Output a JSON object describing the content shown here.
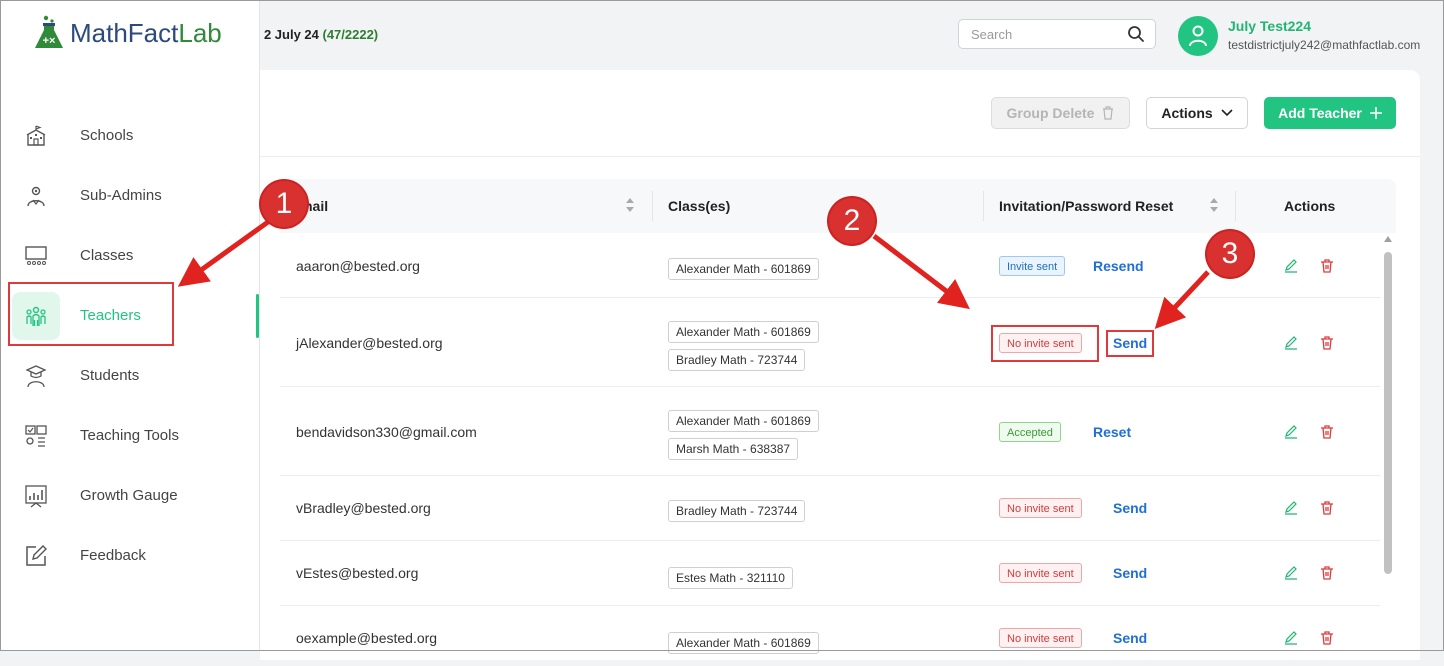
{
  "app": {
    "logo_main": "MathFact",
    "logo_accent": "Lab"
  },
  "header": {
    "term_text": ": 2 July 24 ",
    "term_count": "(47/2222)",
    "search_placeholder": "Search",
    "user_name": "July  Test224",
    "user_email": "testdistrictjuly242@mathfactlab.com"
  },
  "sidebar": {
    "items": [
      {
        "label": "Schools",
        "icon": "school-icon"
      },
      {
        "label": "Sub-Admins",
        "icon": "sub-admin-icon"
      },
      {
        "label": "Classes",
        "icon": "classes-icon"
      },
      {
        "label": "Teachers",
        "icon": "teachers-icon",
        "active": true
      },
      {
        "label": "Students",
        "icon": "student-icon"
      },
      {
        "label": "Teaching Tools",
        "icon": "teaching-tools-icon"
      },
      {
        "label": "Growth Gauge",
        "icon": "growth-gauge-icon"
      },
      {
        "label": "Feedback",
        "icon": "feedback-icon"
      }
    ]
  },
  "toolbar": {
    "group_delete": "Group Delete",
    "actions": "Actions",
    "add_teacher": "Add Teacher"
  },
  "table": {
    "headers": {
      "email": "nail",
      "classes": "Class(es)",
      "invitation": "Invitation/Password Reset",
      "actions": "Actions"
    },
    "rows": [
      {
        "email": "aaaron@bested.org",
        "classes": [
          "Alexander Math - 601869"
        ],
        "status": "Invite sent",
        "action": "Resend"
      },
      {
        "email": "jAlexander@bested.org",
        "classes": [
          "Alexander Math - 601869",
          "Bradley Math - 723744"
        ],
        "status": "No invite sent",
        "action": "Send"
      },
      {
        "email": "bendavidson330@gmail.com",
        "classes": [
          "Alexander Math - 601869",
          "Marsh Math - 638387"
        ],
        "status": "Accepted",
        "action": "Reset"
      },
      {
        "email": "vBradley@bested.org",
        "classes": [
          "Bradley Math - 723744"
        ],
        "status": "No invite sent",
        "action": "Send"
      },
      {
        "email": "vEstes@bested.org",
        "classes": [
          "Estes Math - 321110"
        ],
        "status": "No invite sent",
        "action": "Send"
      },
      {
        "email": "oexample@bested.org",
        "classes": [
          "Alexander Math - 601869"
        ],
        "status": "No invite sent",
        "action": "Send"
      }
    ]
  },
  "annotations": {
    "n1": "1",
    "n2": "2",
    "n3": "3"
  },
  "colors": {
    "brand_green": "#22c482",
    "annotation_red": "#d8312f",
    "link_blue": "#1f6fd6"
  }
}
